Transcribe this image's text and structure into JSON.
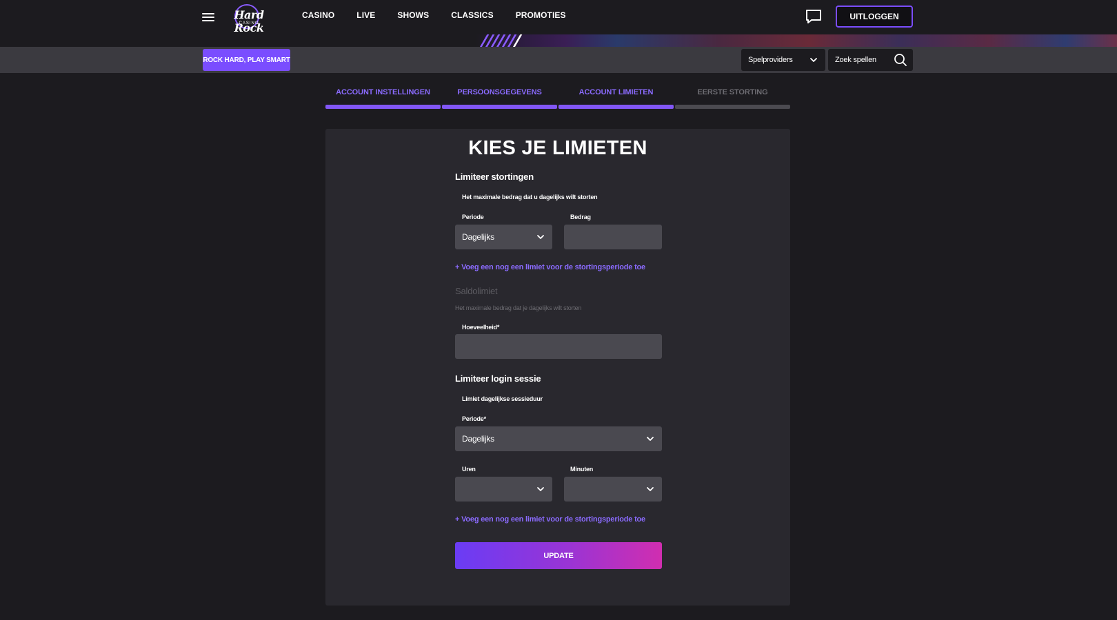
{
  "header": {
    "logo": {
      "word": "Hard Rock",
      "sub": "CASINO"
    },
    "nav": [
      "CASINO",
      "LIVE",
      "SHOWS",
      "CLASSICS",
      "PROMOTIES"
    ],
    "logout_label": "UITLOGGEN"
  },
  "subbar": {
    "promo_label": "ROCK HARD, PLAY SMART",
    "providers_label": "Spelproviders",
    "search_placeholder": "Zoek spellen"
  },
  "steps": [
    {
      "label": "ACCOUNT INSTELLINGEN",
      "completed": true
    },
    {
      "label": "PERSOONSGEGEVENS",
      "completed": true
    },
    {
      "label": "ACCOUNT LIMIETEN",
      "completed": true
    },
    {
      "label": "EERSTE STORTING",
      "completed": false
    }
  ],
  "form": {
    "title": "KIES JE LIMIETEN",
    "deposit": {
      "title": "Limiteer stortingen",
      "hint": "Het maximale bedrag dat u dagelijks wilt storten",
      "period_label": "Periode",
      "period_value": "Dagelijks",
      "amount_label": "Bedrag",
      "amount_value": "",
      "add_link": "+ Voeg een nog een limiet voor de stortingsperiode toe"
    },
    "balance": {
      "title": "Saldolimiet",
      "hint": "Het maximale bedrag dat je dagelijks wilt storten",
      "amount_label": "Hoeveelheid*",
      "amount_value": ""
    },
    "session": {
      "title": "Limiteer login sessie",
      "hint": "Limiet dagelijkse sessieduur",
      "period_label": "Periode*",
      "period_value": "Dagelijks",
      "hours_label": "Uren",
      "hours_value": "",
      "minutes_label": "Minuten",
      "minutes_value": "",
      "add_link": "+ Voeg een nog een limiet voor de stortingsperiode toe"
    },
    "update_label": "UPDATE"
  },
  "icons": {
    "menu": "hamburger-icon",
    "chat": "chat-bubble-icon",
    "chevron": "chevron-down-icon",
    "search": "search-icon"
  },
  "colors": {
    "accent": "#7b4dff",
    "step_active": "#8257f5",
    "background": "#1c1b1f",
    "card": "#29282e",
    "input": "#4a4950"
  }
}
